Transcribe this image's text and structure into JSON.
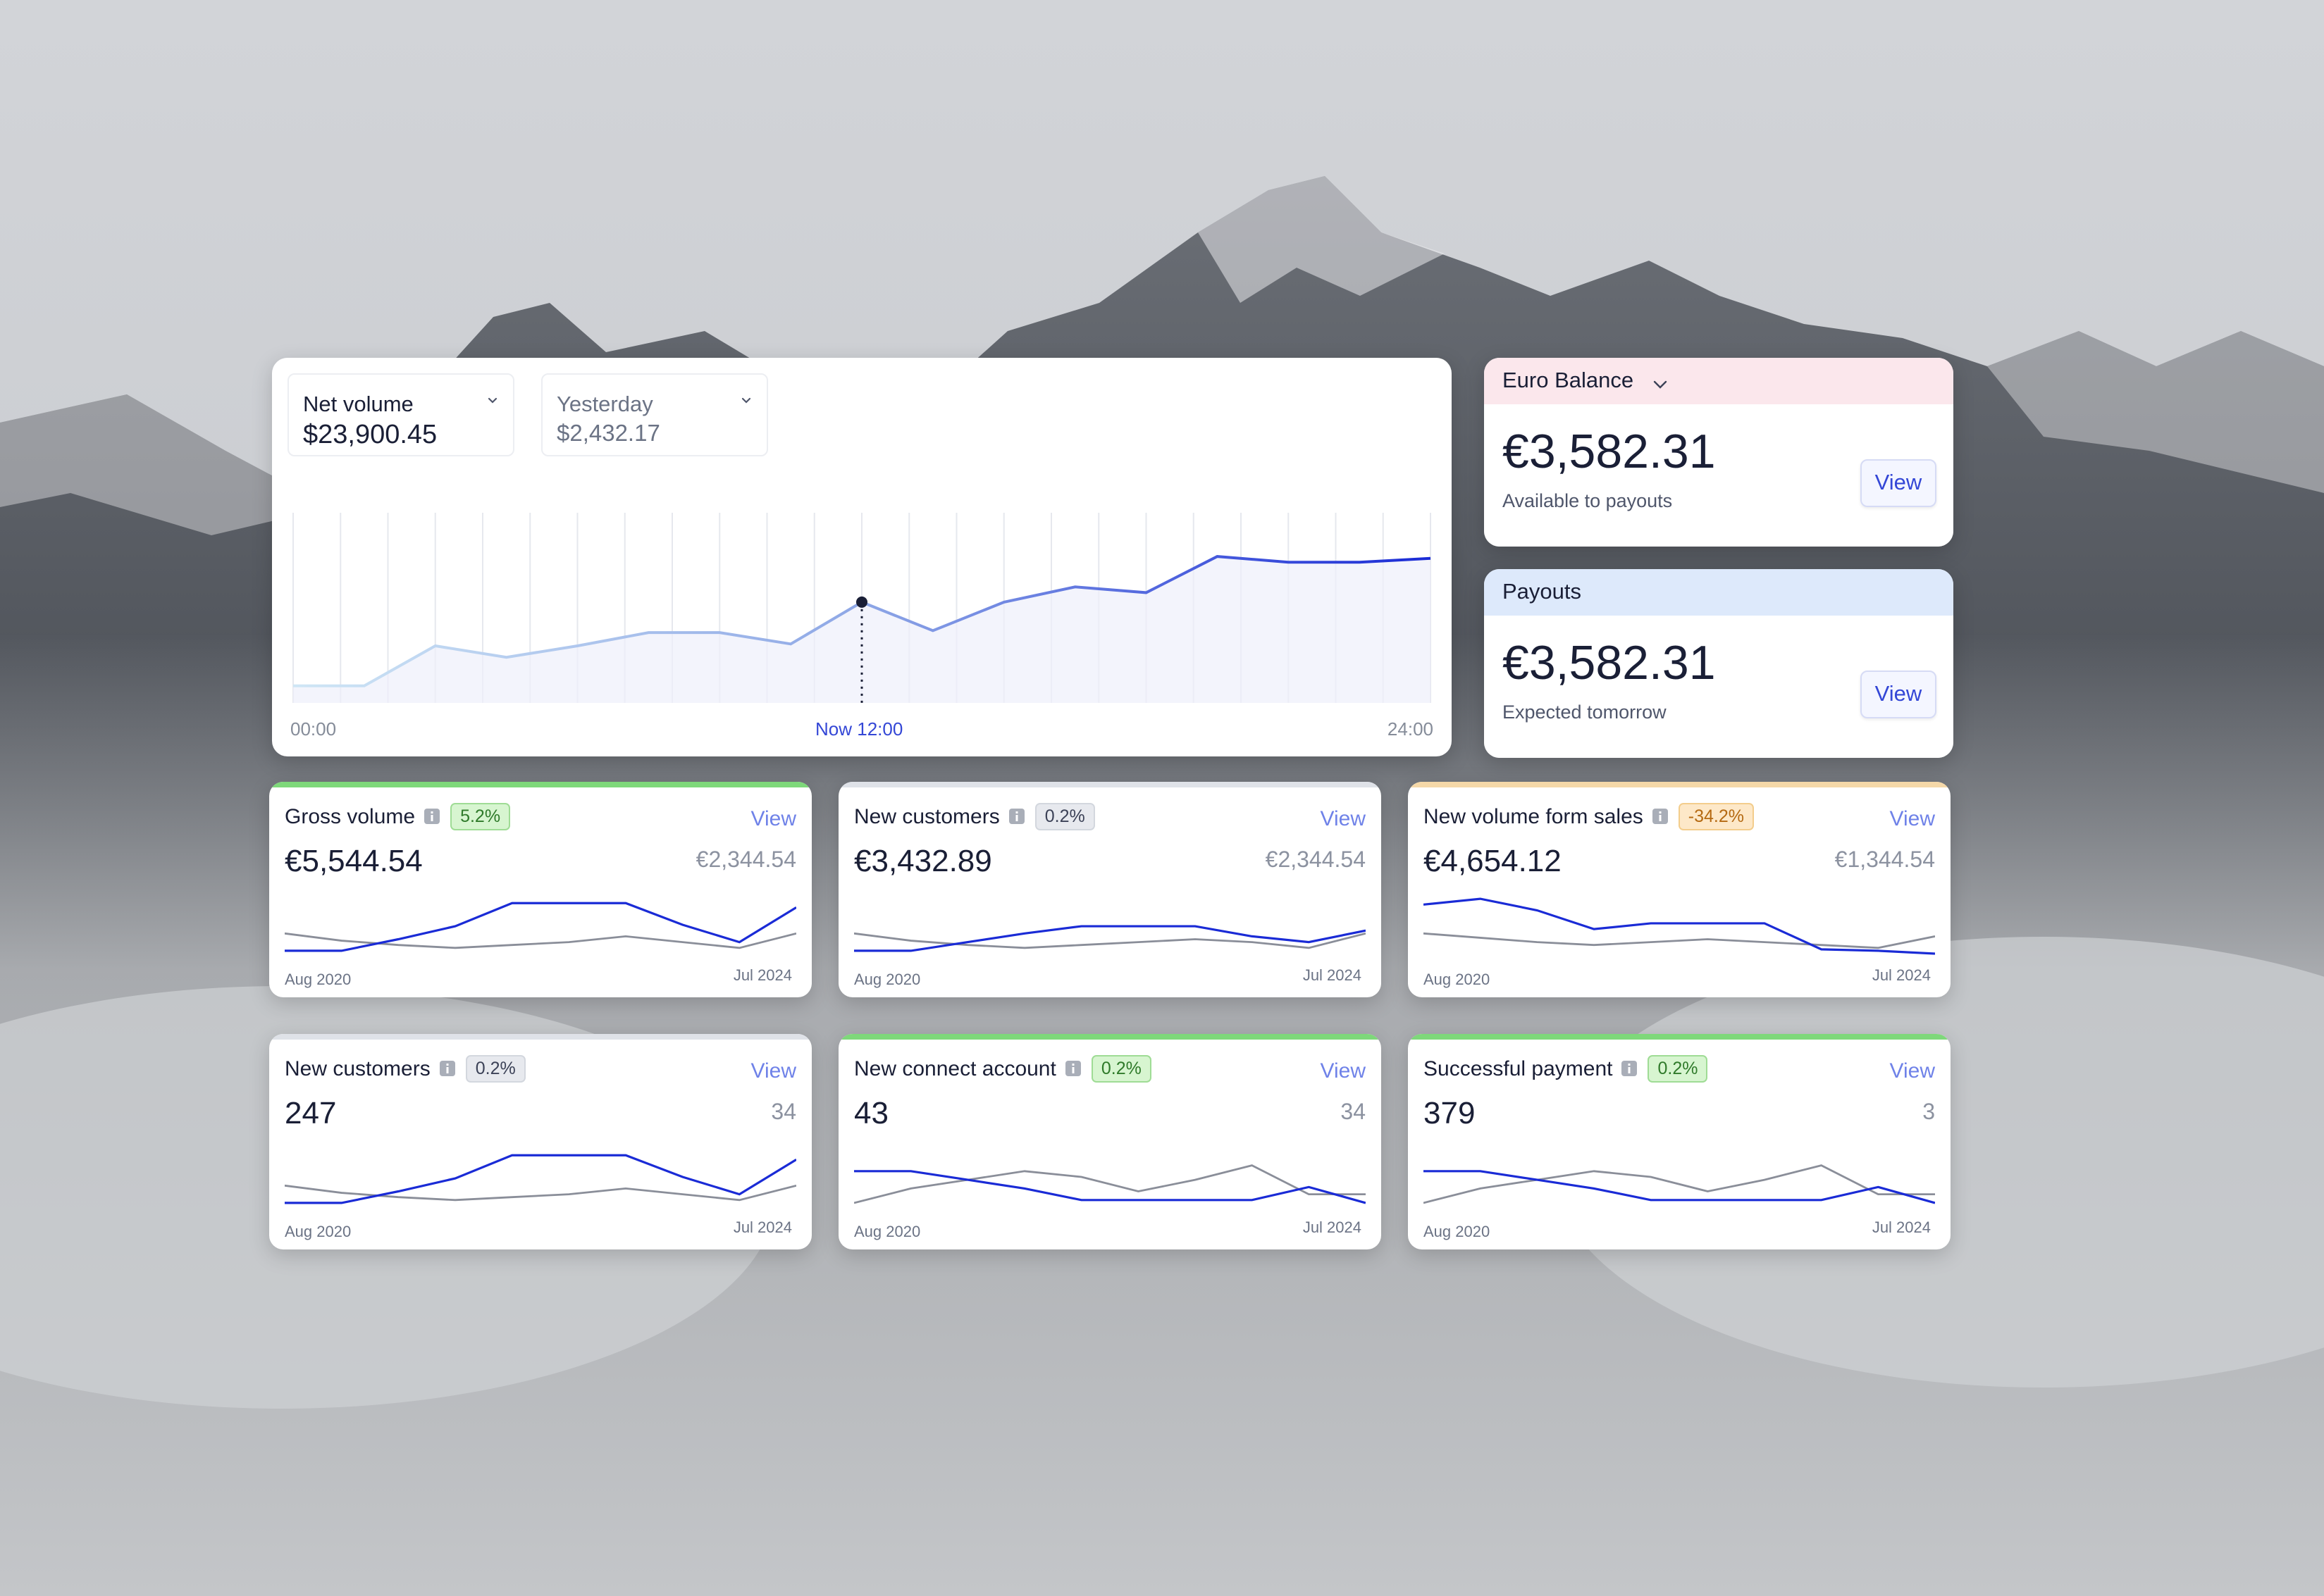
{
  "colors": {
    "accent_blue": "#1a2bd6",
    "grey_line": "#8a8e99",
    "euro_header": "#fbe7ec",
    "payouts_header": "#dde9fb",
    "badge_green_bg": "#d7f5d0",
    "badge_green_fg": "#2f7a2a",
    "badge_grey_bg": "#e7e9ee",
    "badge_orange_bg": "#fde8c8",
    "badge_orange_fg": "#b56a12"
  },
  "main_chart": {
    "metric_selector": {
      "label": "Net volume",
      "value": "$23,900.45"
    },
    "compare_selector": {
      "label": "Yesterday",
      "value": "$2,432.17"
    },
    "x_axis": {
      "start": "00:00",
      "now": "Now 12:00",
      "end": "24:00"
    },
    "series": [
      9,
      9,
      30,
      24,
      30,
      37,
      37,
      31,
      53,
      38,
      53,
      61,
      58,
      77,
      74,
      74,
      76
    ]
  },
  "euro_balance": {
    "title": "Euro Balance",
    "amount": "€3,582.31",
    "caption": "Available to payouts",
    "view_label": "View"
  },
  "payouts": {
    "title": "Payouts",
    "amount": "€3,582.31",
    "caption": "Expected tomorrow",
    "view_label": "View"
  },
  "metrics": [
    {
      "title": "Gross volume",
      "badge": "5.2%",
      "badge_style": "green",
      "top_color": "#7ed87a",
      "view_label": "View",
      "value": "€5,544.54",
      "compare": "€2,344.54",
      "start_label": "Aug 2020",
      "end_label": "Jul 2024",
      "icon": "info-icon",
      "primary": [
        2,
        2,
        10,
        19,
        35,
        35,
        35,
        20,
        8,
        32
      ],
      "secondary": [
        14,
        9,
        6,
        4,
        6,
        8,
        12,
        8,
        4,
        14
      ]
    },
    {
      "title": "New customers",
      "badge": "0.2%",
      "badge_style": "grey",
      "top_color": "#dfe2e8",
      "view_label": "View",
      "value": "€3,432.89",
      "compare": "€2,344.54",
      "start_label": "Aug 2020",
      "end_label": "Jul 2024",
      "icon": "info-icon",
      "primary": [
        2,
        2,
        8,
        14,
        19,
        19,
        19,
        12,
        8,
        16
      ],
      "secondary": [
        14,
        9,
        6,
        4,
        6,
        8,
        10,
        8,
        4,
        14
      ]
    },
    {
      "title": "New volume form sales",
      "badge": "-34.2%",
      "badge_style": "orange",
      "top_color": "#f5d8a8",
      "view_label": "View",
      "value": "€4,654.12",
      "compare": "€1,344.54",
      "start_label": "Aug 2020",
      "end_label": "Jul 2024",
      "icon": "info-icon",
      "primary": [
        34,
        38,
        30,
        17,
        21,
        21,
        21,
        3,
        2,
        0
      ],
      "secondary": [
        14,
        11,
        8,
        6,
        8,
        10,
        8,
        6,
        4,
        12
      ]
    },
    {
      "title": "New customers",
      "badge": "0.2%",
      "badge_style": "grey",
      "top_color": "#dfe2e8",
      "view_label": "View",
      "value": "247",
      "compare": "34",
      "start_label": "Aug 2020",
      "end_label": "Jul 2024",
      "icon": "info-icon",
      "primary": [
        2,
        2,
        10,
        19,
        35,
        35,
        35,
        20,
        8,
        32
      ],
      "secondary": [
        14,
        9,
        6,
        4,
        6,
        8,
        12,
        8,
        4,
        14
      ]
    },
    {
      "title": "New connect account",
      "badge": "0.2%",
      "badge_style": "green",
      "top_color": "#7ed87a",
      "view_label": "View",
      "value": "43",
      "compare": "34",
      "start_label": "Aug 2020",
      "end_label": "Jul 2024",
      "icon": "info-icon",
      "primary": [
        24,
        24,
        18,
        12,
        4,
        4,
        4,
        4,
        13,
        2
      ],
      "secondary": [
        2,
        12,
        18,
        24,
        20,
        10,
        18,
        28,
        8,
        8
      ]
    },
    {
      "title": "Successful payment",
      "badge": "0.2%",
      "badge_style": "green",
      "top_color": "#7ed87a",
      "view_label": "View",
      "value": "379",
      "compare": "3",
      "start_label": "Aug 2020",
      "end_label": "Jul 2024",
      "icon": "info-icon",
      "primary": [
        24,
        24,
        18,
        12,
        4,
        4,
        4,
        4,
        13,
        2
      ],
      "secondary": [
        2,
        12,
        18,
        24,
        20,
        10,
        18,
        28,
        8,
        8
      ]
    }
  ]
}
